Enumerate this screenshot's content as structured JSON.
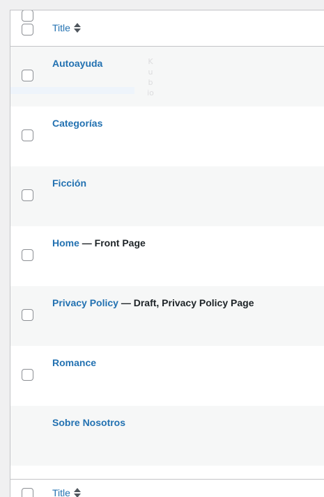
{
  "header": {
    "title_label": "Title"
  },
  "footer": {
    "title_label": "Title"
  },
  "rows": [
    {
      "title": "Autoayuda",
      "state": ""
    },
    {
      "title": "Categorías",
      "state": ""
    },
    {
      "title": "Ficción",
      "state": ""
    },
    {
      "title": "Home",
      "state": " — Front Page"
    },
    {
      "title": "Privacy Policy",
      "state": " — Draft, Privacy Policy Page"
    },
    {
      "title": "Romance",
      "state": ""
    },
    {
      "title": "Sobre Nosotros",
      "state": ""
    }
  ],
  "watermark": {
    "text": "Kubio"
  },
  "colors": {
    "link": "#2271b1",
    "text": "#1d2327",
    "border": "#c3c4c7",
    "alt_row": "#f6f7f7"
  }
}
